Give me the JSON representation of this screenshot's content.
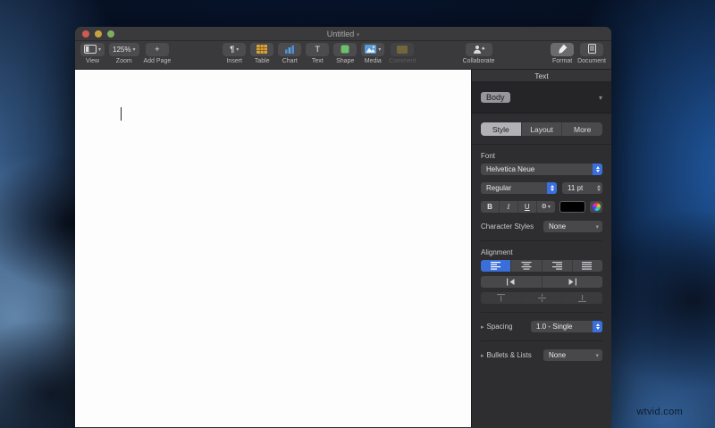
{
  "window": {
    "title": "Untitled",
    "title_chevron": "▾"
  },
  "toolbar": {
    "view": {
      "label": "View"
    },
    "zoom": {
      "label": "Zoom",
      "value": "125%"
    },
    "add_page": {
      "label": "Add Page",
      "glyph": "+"
    },
    "insert": {
      "label": "Insert",
      "glyph": "¶"
    },
    "table": {
      "label": "Table"
    },
    "chart": {
      "label": "Chart"
    },
    "text": {
      "label": "Text",
      "glyph": "T"
    },
    "shape": {
      "label": "Shape"
    },
    "media": {
      "label": "Media"
    },
    "comment": {
      "label": "Comment"
    },
    "collaborate": {
      "label": "Collaborate"
    },
    "format": {
      "label": "Format"
    },
    "document": {
      "label": "Document"
    }
  },
  "sidebar": {
    "header": "Text",
    "paragraph_style": "Body",
    "paragraph_arrow": "▾",
    "tabs": [
      {
        "label": "Style"
      },
      {
        "label": "Layout"
      },
      {
        "label": "More"
      }
    ],
    "font": {
      "section_label": "Font",
      "family": "Helvetica Neue",
      "weight": "Regular",
      "size": "11 pt",
      "bold": "B",
      "italic": "I",
      "underline": "U",
      "more_glyph": "⚙",
      "more_chevron": "▾"
    },
    "character_styles": {
      "label": "Character Styles",
      "value": "None",
      "chevron": "▾"
    },
    "alignment": {
      "section_label": "Alignment"
    },
    "spacing": {
      "label": "Spacing",
      "value": "1.0 - Single",
      "disclosure": "▸"
    },
    "bullets": {
      "label": "Bullets & Lists",
      "value": "None",
      "disclosure": "▸",
      "chevron": "▾"
    }
  },
  "watermark": "wtvid.com",
  "icons": {
    "view-icon": "sidebar-panel-rect",
    "table-icon": "yellow-grid",
    "chart-icon": "blue-bars",
    "shape-icon": "green-square",
    "media-icon": "photo",
    "comment-icon": "dim-yellow-square",
    "collaborate-icon": "person-plus",
    "format-icon": "paintbrush",
    "document-icon": "document-lines",
    "color-wheel-icon": "rainbow-circle"
  },
  "colors": {
    "accent_blue": "#3a6fd9",
    "stepper_blue": "#3a70dd",
    "table_yellow": "#d9a43c",
    "chart_blue": "#4a90d9",
    "shape_green": "#6cbf6c",
    "media_blue": "#5b9bd5",
    "toolbar_bg": "#3a3a3c",
    "sidebar_bg": "#2e2e30",
    "doc_bg": "#fdfdfd"
  }
}
